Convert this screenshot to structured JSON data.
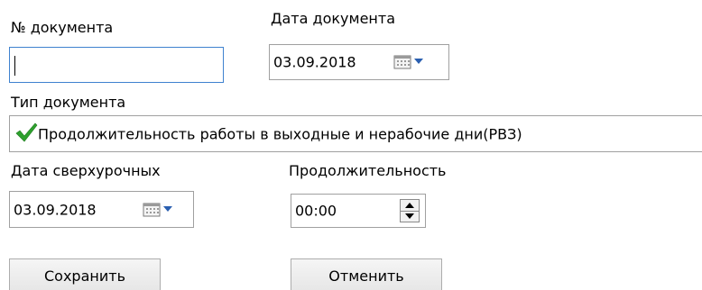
{
  "doc_number": {
    "label": "№ документа",
    "value": ""
  },
  "doc_date": {
    "label": "Дата документа",
    "value": "03.09.2018"
  },
  "doc_type": {
    "label": "Тип документа",
    "value": "Продолжительность работы в выходные и нерабочие дни(РВЗ)"
  },
  "overtime_date": {
    "label": "Дата сверхурочных",
    "value": "03.09.2018"
  },
  "duration": {
    "label": "Продолжительность",
    "value": "00:00"
  },
  "buttons": {
    "save": "Сохранить",
    "cancel": "Отменить"
  },
  "icons": {
    "calendar": "calendar-icon",
    "dropdown": "chevron-down-icon",
    "check": "check-icon",
    "spin_up": "arrow-up-icon",
    "spin_down": "arrow-down-icon"
  },
  "colors": {
    "focus_border": "#3f82cf",
    "check_green": "#2ea12e",
    "arrow_blue": "#2a5fb0"
  }
}
